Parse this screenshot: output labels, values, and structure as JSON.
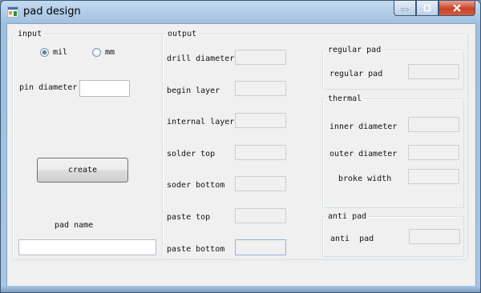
{
  "window": {
    "title": "pad design"
  },
  "caption_buttons": {
    "minimize": "minimize-icon",
    "maximize": "maximize-icon",
    "close": "close-icon"
  },
  "input": {
    "legend": "input",
    "unit_options": [
      {
        "label": "mil",
        "selected": true
      },
      {
        "label": "mm",
        "selected": false
      }
    ],
    "pin_diameter_label": "pin diameter",
    "pin_diameter_value": "",
    "create_label": "create",
    "pad_name_label": "pad name",
    "pad_name_value": ""
  },
  "output": {
    "legend": "output",
    "fields": [
      {
        "label": "drill diameter",
        "value": ""
      },
      {
        "label": "begin layer",
        "value": ""
      },
      {
        "label": "internal layer",
        "value": ""
      },
      {
        "label": "solder top",
        "value": ""
      },
      {
        "label": "soder bottom",
        "value": ""
      },
      {
        "label": "paste top",
        "value": ""
      },
      {
        "label": "paste bottom",
        "value": ""
      }
    ]
  },
  "regular_pad": {
    "legend": "regular pad",
    "label": "regular pad",
    "value": ""
  },
  "thermal": {
    "legend": "thermal",
    "fields": [
      {
        "label": "inner diameter",
        "value": ""
      },
      {
        "label": "outer diameter",
        "value": ""
      },
      {
        "label": "broke width",
        "value": ""
      }
    ]
  },
  "anti_pad": {
    "legend": "anti pad",
    "label": "anti  pad",
    "value": ""
  }
}
